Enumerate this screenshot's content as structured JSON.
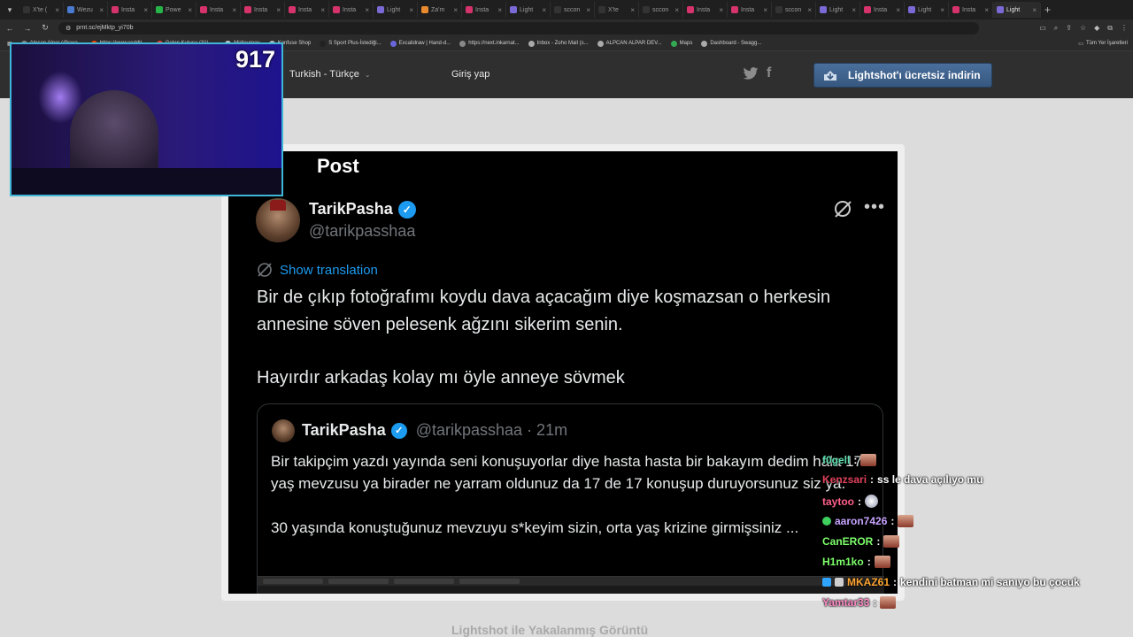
{
  "browser": {
    "tabs": [
      {
        "label": "X'te (",
        "color": "#333333"
      },
      {
        "label": "Wezu",
        "color": "#4a7bd1"
      },
      {
        "label": "Insta",
        "color": "#d6336c"
      },
      {
        "label": "Powe",
        "color": "#27b54a"
      },
      {
        "label": "Insta",
        "color": "#d6336c"
      },
      {
        "label": "Insta",
        "color": "#d6336c"
      },
      {
        "label": "Insta",
        "color": "#d6336c"
      },
      {
        "label": "Insta",
        "color": "#d6336c"
      },
      {
        "label": "Light",
        "color": "#7a6ad6"
      },
      {
        "label": "Za'm",
        "color": "#e88a2d"
      },
      {
        "label": "Insta",
        "color": "#d6336c"
      },
      {
        "label": "Light",
        "color": "#7a6ad6"
      },
      {
        "label": "sccon",
        "color": "#333333"
      },
      {
        "label": "X'te",
        "color": "#333333"
      },
      {
        "label": "sccon",
        "color": "#333333"
      },
      {
        "label": "Insta",
        "color": "#d6336c"
      },
      {
        "label": "Insta",
        "color": "#d6336c"
      },
      {
        "label": "sccon",
        "color": "#333333"
      },
      {
        "label": "Light",
        "color": "#7a6ad6"
      },
      {
        "label": "Insta",
        "color": "#d6336c"
      },
      {
        "label": "Light",
        "color": "#7a6ad6"
      },
      {
        "label": "Insta",
        "color": "#d6336c"
      }
    ],
    "active_tab": {
      "label": "Light",
      "color": "#7a6ad6"
    },
    "url": "prnt.sc/ejMktp_yi70b",
    "bookmarks": [
      {
        "label": "Alpcan Alpar (@swa...",
        "color": "#888888"
      },
      {
        "label": "https://www.reddit....",
        "color": "#ff4500"
      },
      {
        "label": "Gelen Kutusu (31) -...",
        "color": "#ea4335"
      },
      {
        "label": "Midjourney",
        "color": "#cccccc"
      },
      {
        "label": "Konfuse Shop",
        "color": "#bbbbbb"
      },
      {
        "label": "S Sport Plus-İstediği...",
        "color": "#222222"
      },
      {
        "label": "Excalidraw | Hand-d...",
        "color": "#6965db"
      },
      {
        "label": "https://next.inkarnat...",
        "color": "#888888"
      },
      {
        "label": "Inbox - Zoho Mail (s...",
        "color": "#aaaaaa"
      },
      {
        "label": "ALPCAN ALPAR DEV...",
        "color": "#aaaaaa"
      },
      {
        "label": "Maps",
        "color": "#34a853"
      },
      {
        "label": "Dashboard - Swagg...",
        "color": "#aaaaaa"
      }
    ],
    "bookmarks_all": "Tüm Yer İşaretleri"
  },
  "lightshot": {
    "language": "Turkish - Türkçe",
    "login": "Giriş yap",
    "download_button": "Lightshot'ı ücretsiz indirin",
    "caption": "Lightshot ile Yakalanmış Görüntü"
  },
  "tweet": {
    "header": "Post",
    "author": "TarikPasha",
    "handle": "@tarikpasshaa",
    "show_translation": "Show translation",
    "paragraphs": [
      "Bir de çıkıp fotoğrafımı koydu dava açacağım diye koşmazsan o herkesin annesine söven pelesenk ağzını sikerim senin.",
      "Hayırdır arkadaş kolay mı öyle anneye sövmek"
    ],
    "quote": {
      "author": "TarikPasha",
      "meta": "@tarikpasshaa · 21m",
      "paragraphs": [
        "Bir takipçim yazdı yayında seni konuşuyorlar diye hasta hasta bir bakayım dedim hala 17 yaş mevzusu ya birader ne yarram oldunuz da 17 de 17 konuşup duruyorsunuz siz ya.",
        "30 yaşında konuştuğunuz mevzuyu s*keyim sizin, orta yaş krizine girmişsiniz ..."
      ]
    }
  },
  "webcam": {
    "counter": "917"
  },
  "chat": [
    {
      "user": "f0gell",
      "color": "#5de0b0",
      "text": "",
      "emote": "face"
    },
    {
      "user": "Kenzsari",
      "color": "#e0415a",
      "text": "ss le dava açılıyo mu",
      "emote": ""
    },
    {
      "user": "taytoo",
      "color": "#ff5f8a",
      "text": "",
      "emote": "ghost"
    },
    {
      "user": "aaron7426",
      "color": "#c7a3ff",
      "text": "",
      "emote": "face"
    },
    {
      "user": "CanEROR",
      "color": "#7dff6a",
      "text": "",
      "emote": "face"
    },
    {
      "user": "H1m1ko",
      "color": "#7dff6a",
      "text": "",
      "emote": "face"
    },
    {
      "user": "MKAZ61",
      "color": "#ffa531",
      "text": "kendini batman mi sanıyo bu çocuk",
      "emote": ""
    },
    {
      "user": "Yamtar33",
      "color": "#ff8cc6",
      "text": "",
      "emote": "face"
    }
  ]
}
